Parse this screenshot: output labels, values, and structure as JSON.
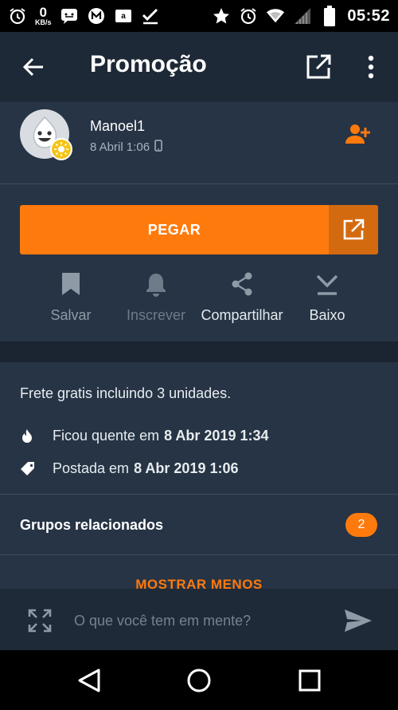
{
  "status_bar": {
    "net_speed_value": "0",
    "net_speed_unit": "KB/s",
    "time": "05:52",
    "left_icons": [
      "alarm-icon",
      "netspeed",
      "messenger-icon",
      "gmail-icon",
      "amazon-icon",
      "task-check-icon"
    ],
    "right_icons": [
      "star-icon",
      "alarm-icon",
      "wifi-icon",
      "signal-icon",
      "battery-icon"
    ]
  },
  "app_bar": {
    "title": "Promoção",
    "icons": [
      "back-arrow-icon",
      "open-external-icon",
      "more-vert-icon"
    ]
  },
  "post": {
    "author_name": "Manoel1",
    "date": "8 Abril 1:06",
    "date_icon": "phone-icon",
    "follow_icon": "person-add-icon"
  },
  "get_button": {
    "label": "PEGAR",
    "icon": "open-external-icon"
  },
  "actions": [
    {
      "label": "Salvar",
      "icon": "bookmark-icon"
    },
    {
      "label": "Inscrever",
      "icon": "bell-icon"
    },
    {
      "label": "Compartilhar",
      "icon": "share-icon"
    },
    {
      "label": "Baixo",
      "icon": "chevron-down-icon"
    }
  ],
  "details": {
    "description": "Frete gratis incluindo 3 unidades.",
    "hot_prefix": "Ficou quente em",
    "hot_date": "8 Abr 2019 1:34",
    "posted_prefix": "Postada em",
    "posted_date": "8 Abr 2019 1:06"
  },
  "groups": {
    "label": "Grupos relacionados",
    "count": "2"
  },
  "show_less_label": "MOSTRAR MENOS",
  "composer": {
    "placeholder": "O que você tem em mente?",
    "icons": [
      "expand-icon",
      "send-icon"
    ]
  },
  "nav_bar": {
    "icons": [
      "back-triangle-icon",
      "home-circle-icon",
      "recents-square-icon"
    ]
  },
  "colors": {
    "accent": "#ff7a0d",
    "background": "#263445",
    "app_bar": "#1e2937"
  }
}
